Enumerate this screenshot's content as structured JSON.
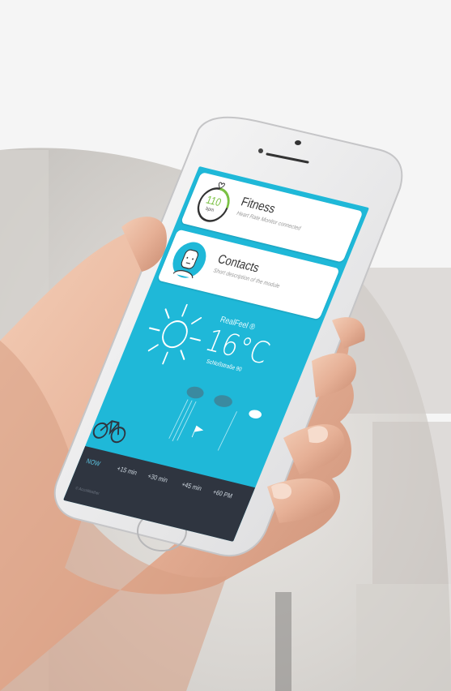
{
  "fitness": {
    "bpm_value": "110",
    "bpm_unit": "bpm",
    "title": "Fitness",
    "subtitle": "Heart Rate Monitor connected"
  },
  "contacts": {
    "title": "Contacts",
    "subtitle": "Short description of the module"
  },
  "weather": {
    "realfeel": "RealFeel ®",
    "temperature": "16°C",
    "location": "Schloßstraße 90"
  },
  "timeline": {
    "tabs": [
      "NOW",
      "+15 min",
      "+30 min",
      "+45 min",
      "+60 PM"
    ],
    "credit": "© AccuWeather"
  },
  "colors": {
    "screen_bg": "#1fb8d8",
    "accent_green": "#7ac143",
    "bar_bg": "#2f3540"
  }
}
